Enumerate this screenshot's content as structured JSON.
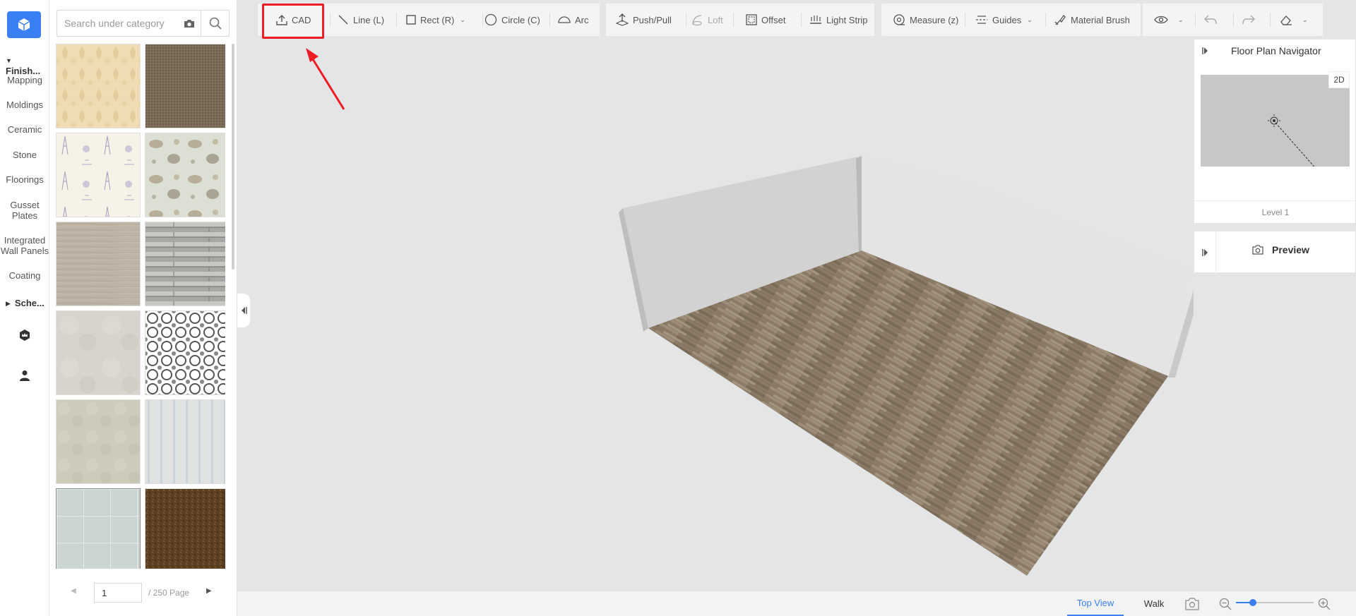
{
  "rail": {
    "groups": [
      {
        "label": "Finish..."
      },
      {
        "label": "Sche..."
      }
    ],
    "items": [
      "Mapping",
      "Moldings",
      "Ceramic",
      "Stone",
      "Floorings",
      "Gusset Plates",
      "Integrated Wall Panels",
      "Coating"
    ]
  },
  "search": {
    "placeholder": "Search under category"
  },
  "materials": [
    {
      "color": "#efdcb2",
      "pattern": "damask-cream"
    },
    {
      "color": "#7a6a58",
      "pattern": "weave-brown"
    },
    {
      "color": "#f6f2e8",
      "pattern": "eiffel-toile"
    },
    {
      "color": "#dcdfd4",
      "pattern": "animal-toile"
    },
    {
      "color": "#bdb4a6",
      "pattern": "wood-grey"
    },
    {
      "color": "#a8a7a6",
      "pattern": "planks-grey"
    },
    {
      "color": "#d8d3cc",
      "pattern": "marble-light"
    },
    {
      "color": "#ffffff",
      "pattern": "circle-lattice"
    },
    {
      "color": "#cdcbba",
      "pattern": "plaster-sage"
    },
    {
      "color": "#dfe2e3",
      "pattern": "stripes-blue"
    },
    {
      "color": "#c6d0cc",
      "pattern": "tiles-mint"
    },
    {
      "color": "#5c3f22",
      "pattern": "granite-brown"
    }
  ],
  "pagination": {
    "current": "1",
    "total_label": "/ 250 Page"
  },
  "toolbar": {
    "cad": "CAD",
    "line": "Line (L)",
    "rect": "Rect (R)",
    "circle": "Circle (C)",
    "arc": "Arc",
    "push_pull": "Push/Pull",
    "loft": "Loft",
    "offset": "Offset",
    "light_strip": "Light Strip",
    "measure": "Measure (z)",
    "guides": "Guides",
    "material_brush": "Material Brush"
  },
  "navigator": {
    "title": "Floor Plan Navigator",
    "mode": "2D",
    "level": "Level 1"
  },
  "preview": {
    "label": "Preview"
  },
  "views": {
    "top": "Top View",
    "walk": "Walk"
  },
  "zoom": {
    "level": 0.22
  },
  "colors": {
    "accent": "#3b7ff5",
    "highlight": "#ef1c24",
    "floor": "#8a7a66"
  }
}
